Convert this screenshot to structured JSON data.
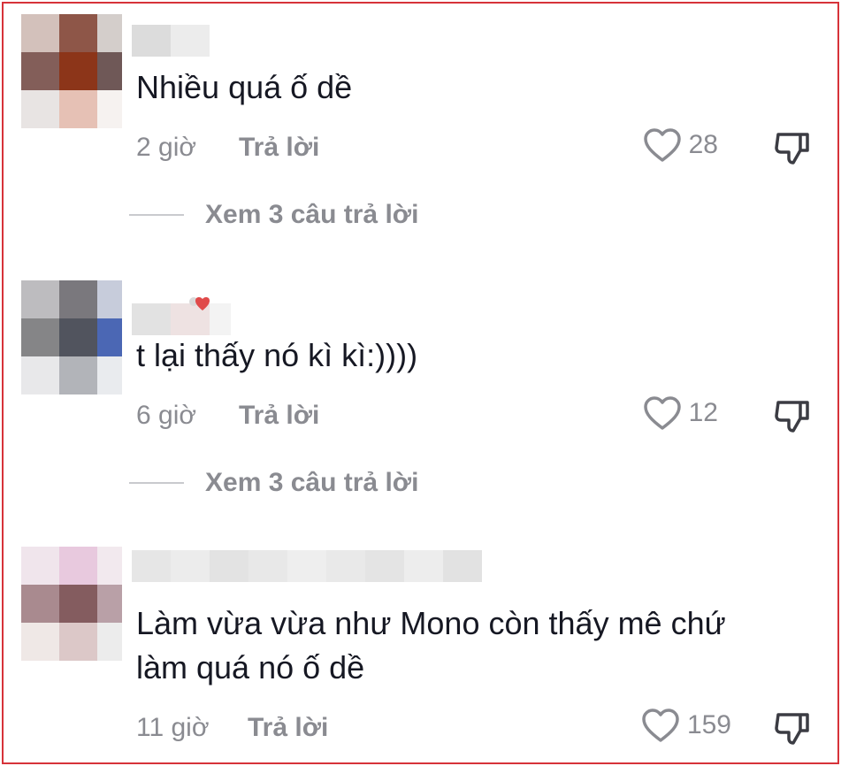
{
  "comments": [
    {
      "text": "Nhiều quá ố dề",
      "time": "2 giờ",
      "reply_label": "Trả lời",
      "likes": "28",
      "view_replies": "Xem 3 câu trả lời"
    },
    {
      "text": "t lại thấy nó kì kì:))))",
      "time": "6 giờ",
      "reply_label": "Trả lời",
      "likes": "12",
      "view_replies": "Xem 3 câu trả lời"
    },
    {
      "text_line1": "Làm vừa vừa như Mono còn thấy mê chứ",
      "text_line2": "làm quá nó ố dề",
      "time": "11 giờ",
      "reply_label": "Trả lời",
      "likes": "159"
    }
  ],
  "colors": {
    "text": "#161823",
    "muted": "#8a8b91",
    "frame": "#d6333a"
  },
  "icons": [
    "heart-outline-icon",
    "thumbs-down-icon"
  ]
}
